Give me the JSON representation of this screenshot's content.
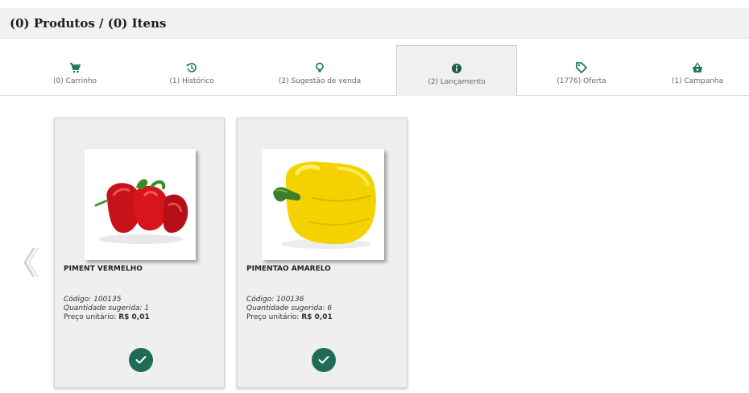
{
  "header": {
    "title": "(0) Produtos / (0) Itens"
  },
  "tabs": [
    {
      "label": "(0) Carrinho",
      "icon": "cart-icon"
    },
    {
      "label": "(1) Histórico",
      "icon": "history-icon"
    },
    {
      "label": "(2) Sugestão de venda",
      "icon": "lightbulb-icon"
    },
    {
      "label": "(2) Lançamento",
      "icon": "info-icon",
      "active": true
    },
    {
      "label": "(1776) Oferta",
      "icon": "tag-icon"
    },
    {
      "label": "(1) Campanha",
      "icon": "basket-icon"
    }
  ],
  "products": [
    {
      "name": "PIMENT VERMELHO",
      "code_label": "Código: 100135",
      "qty_label": "Quantidade sugerida: 1",
      "price_label": "Preço unitário: ",
      "price_value": "R$ 0,01",
      "image": "red-pepper-photo"
    },
    {
      "name": "PIMENTAO AMARELO",
      "code_label": "Código: 100136",
      "qty_label": "Quantidade sugerida: 6",
      "price_label": "Preço unitário: ",
      "price_value": "R$ 0,01",
      "image": "yellow-pepper-photo"
    }
  ],
  "colors": {
    "accent": "#1f6b55",
    "icon_green": "#1e7a5a",
    "header_bg": "#f1f1f1"
  }
}
